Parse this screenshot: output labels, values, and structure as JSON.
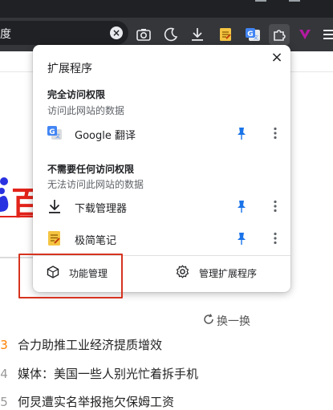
{
  "toolbar": {
    "omnibox_text": "度",
    "clear_symbol": "×",
    "icons": [
      "screenshot-icon",
      "dark-mode-icon",
      "download-icon",
      "notes-extension-icon",
      "google-translate-icon",
      "extensions-puzzle-icon",
      "extension-v-icon",
      "menu-icon"
    ]
  },
  "popup": {
    "title": "扩展程序",
    "close_symbol": "×",
    "full_access": {
      "title": "完全访问权限",
      "subtitle": "访问此网站的数据",
      "items": [
        {
          "name": "Google 翻译",
          "icon": "google-translate-icon"
        }
      ]
    },
    "no_access": {
      "title": "不需要任何访问权限",
      "subtitle": "无法访问此网站的数据",
      "items": [
        {
          "name": "下载管理器",
          "icon": "download-icon"
        },
        {
          "name": "极简笔记",
          "icon": "notes-icon"
        }
      ]
    },
    "footer": {
      "left_label": "功能管理",
      "right_label": "管理扩展程序"
    }
  },
  "page": {
    "logo_fragment": "百",
    "refresh_label": "换一换",
    "hot_list": [
      {
        "rank": "3",
        "title": "合力助推工业经济提质增效"
      },
      {
        "rank": "4",
        "title": "媒体：美国一些人别光忙着拆手机"
      },
      {
        "rank": "5",
        "title": "何炅遭实名举报拖欠保姆工资"
      }
    ]
  },
  "colors": {
    "chrome_dark": "#35363a",
    "pin_blue": "#1a73e8",
    "highlight_red": "#d6331f",
    "baidu_red": "#e2231a",
    "baidu_blue": "#2932e1",
    "hot_rank_orange": "#ff7f00"
  }
}
